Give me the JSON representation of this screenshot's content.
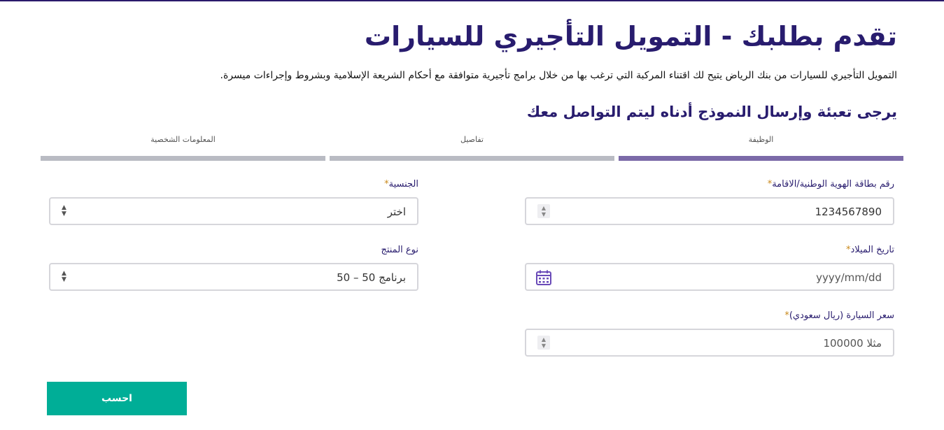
{
  "page": {
    "title": "تقدم بطلبك - التمويل التأجيري للسيارات",
    "description": "التمويل التأجيري للسيارات من بنك الرياض يتيح لك اقتناء المركبة التي ترغب بها من خلال برامج تأجيرية متوافقة مع أحكام الشريعة الإسلامية وبشروط وإجراءات ميسرة.",
    "form_heading": "يرجى تعبئة وإرسال النموذج أدناه ليتم التواصل معك"
  },
  "steps": [
    {
      "label": "الوظيفة",
      "active": true
    },
    {
      "label": "تفاصيل",
      "active": false
    },
    {
      "label": "المعلومات الشخصية",
      "active": false
    }
  ],
  "fields": {
    "id_number": {
      "label": "رقم بطاقة الهوية الوطنية/الاقامة",
      "required_mark": "*",
      "value": "1234567890"
    },
    "nationality": {
      "label": "الجنسية",
      "required_mark": "*",
      "value": "اختر"
    },
    "birth_date": {
      "label": "تاريخ الميلاد",
      "required_mark": "*",
      "placeholder": "yyyy/mm/dd"
    },
    "product_type": {
      "label": "نوع المنتج",
      "value": "برنامج 50 – 50"
    },
    "car_price": {
      "label": "سعر السيارة (ريال سعودي)",
      "required_mark": "*",
      "placeholder": "مثلا 100000"
    }
  },
  "buttons": {
    "calculate": "احسب"
  },
  "colors": {
    "primary": "#281c6e",
    "accent": "#00ae97",
    "step_active": "#7b6aa8",
    "step_inactive": "#b9bbc3",
    "required": "#c9891b"
  },
  "icons": {
    "spinner": "number-spinner-icon",
    "select": "select-arrows-icon",
    "calendar": "calendar-icon"
  }
}
